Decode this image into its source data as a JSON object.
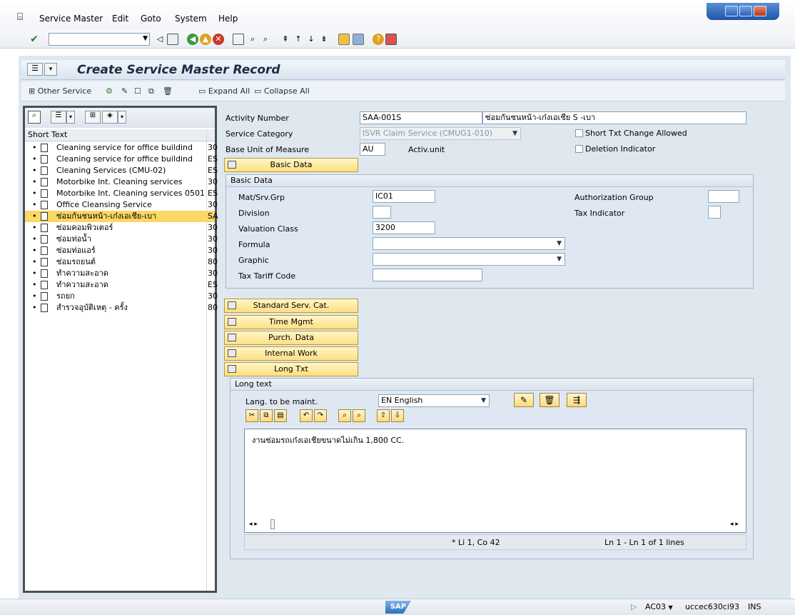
{
  "menu": {
    "items": [
      {
        "label": "Service Master"
      },
      {
        "label": "Edit"
      },
      {
        "label": "Goto"
      },
      {
        "label": "System"
      },
      {
        "label": "Help"
      }
    ]
  },
  "screen": {
    "title": "Create Service Master Record"
  },
  "app_toolbar": {
    "other_service": "Other Service",
    "expand_all": "Expand All",
    "collapse_all": "Collapse All"
  },
  "tree": {
    "header": "Short Text",
    "items": [
      {
        "label": "Cleaning service for office buildind",
        "code": "30"
      },
      {
        "label": "Cleaning service for office buildind",
        "code": "ES"
      },
      {
        "label": "Cleaning Services (CMU-02)",
        "code": "ES"
      },
      {
        "label": "Motorbike Int. Cleaning services",
        "code": "30"
      },
      {
        "label": "Motorbike Int. Cleaning services 0501",
        "code": "ES"
      },
      {
        "label": "Office Cleansing Service",
        "code": "30"
      },
      {
        "label": "ซ่อมกันชนหน้า-เก๋งเอเชีย-เบา",
        "code": "SA",
        "selected": true
      },
      {
        "label": "ซ่อมคอมพิวเตอร์",
        "code": "30"
      },
      {
        "label": "ซ่อมท่อน้ำ",
        "code": "30"
      },
      {
        "label": "ซ่อมท่อแอร์",
        "code": "30"
      },
      {
        "label": "ซ่อมรถยนต์",
        "code": "80"
      },
      {
        "label": "ทำความสะอาด",
        "code": "30"
      },
      {
        "label": "ทำความสะอาด",
        "code": "ES"
      },
      {
        "label": "รถยก",
        "code": "30"
      },
      {
        "label": "สำรวจอุบัติเหตุ - ครั้ง",
        "code": "80"
      }
    ]
  },
  "header_fields": {
    "activity_number_label": "Activity Number",
    "activity_number": "SAA-001S",
    "activity_desc": "ซ่อมกันชนหน้า-เก๋งเอเชีย S -เบา",
    "service_category_label": "Service Category",
    "service_category": "ISVR Claim Service (CMUG1-010)",
    "short_txt_change_label": "Short Txt Change Allowed",
    "base_uom_label": "Base Unit of Measure",
    "base_uom": "AU",
    "base_uom_text": "Activ.unit",
    "deletion_indicator_label": "Deletion Indicator"
  },
  "basic_data": {
    "button": "Basic Data",
    "group_title": "Basic Data",
    "mat_srv_grp_label": "Mat/Srv.Grp",
    "mat_srv_grp": "IC01",
    "division_label": "Division",
    "division": "",
    "valuation_class_label": "Valuation Class",
    "valuation_class": "3200",
    "formula_label": "Formula",
    "graphic_label": "Graphic",
    "tax_tariff_label": "Tax Tariff Code",
    "auth_group_label": "Authorization Group",
    "tax_indicator_label": "Tax Indicator"
  },
  "section_buttons": [
    {
      "label": "Standard Serv. Cat."
    },
    {
      "label": "Time Mgmt"
    },
    {
      "label": "Purch. Data"
    },
    {
      "label": "Internal Work"
    },
    {
      "label": "Long Txt"
    }
  ],
  "long_text": {
    "group_title": "Long text",
    "lang_label": "Lang. to be maint.",
    "lang_value": "EN English",
    "text": "งานซ่อมรถเก๋งเอเชียขนาดไม่เกิน 1,800 CC.",
    "cursor_pos": "* Li 1, Co 42",
    "line_info": "Ln 1 - Ln 1 of 1 lines"
  },
  "status_bar": {
    "system": "AC03",
    "server": "uccec630ci93",
    "mode": "INS",
    "logo": "SAP"
  },
  "colors": {
    "selection": "#fbd765",
    "button_yellow": "#ffe081",
    "group_bg": "#dfe8f2",
    "title_text": "#1b2c44"
  }
}
